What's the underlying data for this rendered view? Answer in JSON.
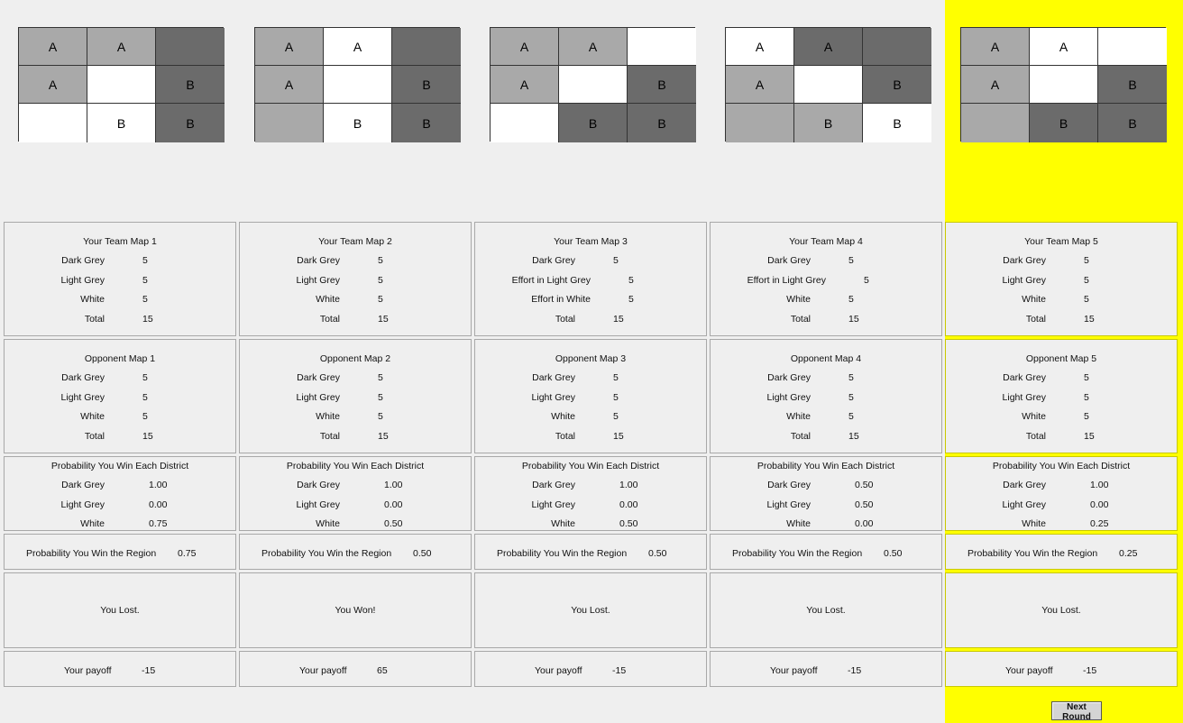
{
  "highlight_color": "#ffff00",
  "colors": {
    "dark": "#6b6b6b",
    "light": "#a9a9a9",
    "white": "#ffffff"
  },
  "next_round_label": "Next Round",
  "district_labels": {
    "dark": "Dark Grey",
    "light": "Light Grey",
    "white": "White",
    "effort_light": "Effort in Light Grey",
    "effort_white": "Effort in White",
    "total": "Total"
  },
  "prob_title": "Probability You Win Each District",
  "region_label": "Probability You Win the Region",
  "payoff_label": "Your payoff",
  "maps": [
    {
      "grid": [
        {
          "c": "light",
          "t": "A"
        },
        {
          "c": "light",
          "t": "A"
        },
        {
          "c": "dark",
          "t": ""
        },
        {
          "c": "light",
          "t": "A"
        },
        {
          "c": "white",
          "t": ""
        },
        {
          "c": "dark",
          "t": "B"
        },
        {
          "c": "white",
          "t": ""
        },
        {
          "c": "white",
          "t": "B"
        },
        {
          "c": "dark",
          "t": "B"
        }
      ],
      "team": {
        "title": "Your Team Map 1",
        "rows": [
          [
            "Dark Grey",
            "5"
          ],
          [
            "Light Grey",
            "5"
          ],
          [
            "White",
            "5"
          ],
          [
            "Total",
            "15"
          ]
        ]
      },
      "opponent": {
        "title": "Opponent Map 1",
        "rows": [
          [
            "Dark Grey",
            "5"
          ],
          [
            "Light Grey",
            "5"
          ],
          [
            "White",
            "5"
          ],
          [
            "Total",
            "15"
          ]
        ]
      },
      "prob": [
        [
          "Dark Grey",
          "1.00"
        ],
        [
          "Light Grey",
          "0.00"
        ],
        [
          "White",
          "0.75"
        ]
      ],
      "region_prob": "0.75",
      "result": "You Lost.",
      "payoff": "-15"
    },
    {
      "grid": [
        {
          "c": "light",
          "t": "A"
        },
        {
          "c": "white",
          "t": "A"
        },
        {
          "c": "dark",
          "t": ""
        },
        {
          "c": "light",
          "t": "A"
        },
        {
          "c": "white",
          "t": ""
        },
        {
          "c": "dark",
          "t": "B"
        },
        {
          "c": "light",
          "t": ""
        },
        {
          "c": "white",
          "t": "B"
        },
        {
          "c": "dark",
          "t": "B"
        }
      ],
      "team": {
        "title": "Your Team Map 2",
        "rows": [
          [
            "Dark Grey",
            "5"
          ],
          [
            "Light Grey",
            "5"
          ],
          [
            "White",
            "5"
          ],
          [
            "Total",
            "15"
          ]
        ]
      },
      "opponent": {
        "title": "Opponent Map 2",
        "rows": [
          [
            "Dark Grey",
            "5"
          ],
          [
            "Light Grey",
            "5"
          ],
          [
            "White",
            "5"
          ],
          [
            "Total",
            "15"
          ]
        ]
      },
      "prob": [
        [
          "Dark Grey",
          "1.00"
        ],
        [
          "Light Grey",
          "0.00"
        ],
        [
          "White",
          "0.50"
        ]
      ],
      "region_prob": "0.50",
      "result": "You Won!",
      "payoff": "65"
    },
    {
      "grid": [
        {
          "c": "light",
          "t": "A"
        },
        {
          "c": "light",
          "t": "A"
        },
        {
          "c": "white",
          "t": ""
        },
        {
          "c": "light",
          "t": "A"
        },
        {
          "c": "white",
          "t": ""
        },
        {
          "c": "dark",
          "t": "B"
        },
        {
          "c": "white",
          "t": ""
        },
        {
          "c": "dark",
          "t": "B"
        },
        {
          "c": "dark",
          "t": "B"
        }
      ],
      "team": {
        "title": "Your Team Map 3",
        "rows": [
          [
            "Dark Grey",
            "5"
          ],
          [
            "Effort in Light Grey",
            "5"
          ],
          [
            "Effort in White",
            "5"
          ],
          [
            "Total",
            "15"
          ]
        ]
      },
      "opponent": {
        "title": "Opponent Map 3",
        "rows": [
          [
            "Dark Grey",
            "5"
          ],
          [
            "Light Grey",
            "5"
          ],
          [
            "White",
            "5"
          ],
          [
            "Total",
            "15"
          ]
        ]
      },
      "prob": [
        [
          "Dark Grey",
          "1.00"
        ],
        [
          "Light Grey",
          "0.00"
        ],
        [
          "White",
          "0.50"
        ]
      ],
      "region_prob": "0.50",
      "result": "You Lost.",
      "payoff": "-15"
    },
    {
      "grid": [
        {
          "c": "white",
          "t": "A"
        },
        {
          "c": "dark",
          "t": "A"
        },
        {
          "c": "dark",
          "t": ""
        },
        {
          "c": "light",
          "t": "A"
        },
        {
          "c": "white",
          "t": ""
        },
        {
          "c": "dark",
          "t": "B"
        },
        {
          "c": "light",
          "t": ""
        },
        {
          "c": "light",
          "t": "B"
        },
        {
          "c": "white",
          "t": "B"
        }
      ],
      "team": {
        "title": "Your Team Map 4",
        "rows": [
          [
            "Dark Grey",
            "5"
          ],
          [
            "Effort in Light Grey",
            "5"
          ],
          [
            "White",
            "5"
          ],
          [
            "Total",
            "15"
          ]
        ]
      },
      "opponent": {
        "title": "Opponent Map 4",
        "rows": [
          [
            "Dark Grey",
            "5"
          ],
          [
            "Light Grey",
            "5"
          ],
          [
            "White",
            "5"
          ],
          [
            "Total",
            "15"
          ]
        ]
      },
      "prob": [
        [
          "Dark Grey",
          "0.50"
        ],
        [
          "Light Grey",
          "0.50"
        ],
        [
          "White",
          "0.00"
        ]
      ],
      "region_prob": "0.50",
      "result": "You Lost.",
      "payoff": "-15"
    },
    {
      "grid": [
        {
          "c": "light",
          "t": "A"
        },
        {
          "c": "white",
          "t": "A"
        },
        {
          "c": "white",
          "t": ""
        },
        {
          "c": "light",
          "t": "A"
        },
        {
          "c": "white",
          "t": ""
        },
        {
          "c": "dark",
          "t": "B"
        },
        {
          "c": "light",
          "t": ""
        },
        {
          "c": "dark",
          "t": "B"
        },
        {
          "c": "dark",
          "t": "B"
        }
      ],
      "team": {
        "title": "Your Team Map 5",
        "rows": [
          [
            "Dark Grey",
            "5"
          ],
          [
            "Light Grey",
            "5"
          ],
          [
            "White",
            "5"
          ],
          [
            "Total",
            "15"
          ]
        ]
      },
      "opponent": {
        "title": "Opponent Map 5",
        "rows": [
          [
            "Dark Grey",
            "5"
          ],
          [
            "Light Grey",
            "5"
          ],
          [
            "White",
            "5"
          ],
          [
            "Total",
            "15"
          ]
        ]
      },
      "prob": [
        [
          "Dark Grey",
          "1.00"
        ],
        [
          "Light Grey",
          "0.00"
        ],
        [
          "White",
          "0.25"
        ]
      ],
      "region_prob": "0.25",
      "result": "You Lost.",
      "payoff": "-15"
    }
  ]
}
